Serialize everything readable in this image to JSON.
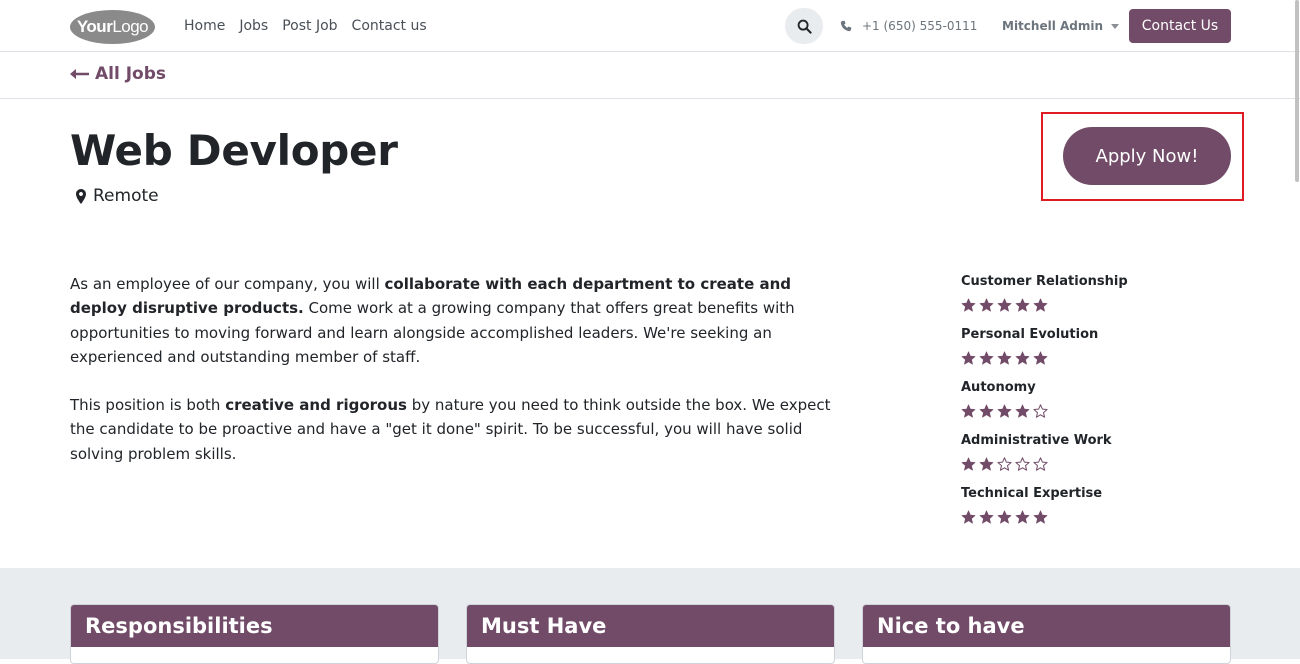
{
  "navbar": {
    "logo_light": "Your",
    "logo_text": "Logo",
    "menu": [
      "Home",
      "Jobs",
      "Post Job",
      "Contact us"
    ],
    "phone": "+1 (650) 555-0111",
    "user": "Mitchell Admin",
    "contact_button": "Contact Us"
  },
  "subnav": {
    "back_label": "All Jobs"
  },
  "job": {
    "title": "Web Devloper",
    "location": "Remote",
    "apply_button": "Apply Now!"
  },
  "description": {
    "p1": [
      {
        "text": "As an employee of our company, you will ",
        "bold": false
      },
      {
        "text": "collaborate with each department to create and deploy disruptive products.",
        "bold": true
      },
      {
        "text": " Come work at a growing company that offers great benefits with opportunities to moving forward and learn alongside accomplished leaders. We're seeking an experienced and outstanding member of staff.",
        "bold": false
      }
    ],
    "p2": [
      {
        "text": "This position is both ",
        "bold": false
      },
      {
        "text": "creative and rigorous",
        "bold": true
      },
      {
        "text": " by nature you need to think outside the box. We expect the candidate to be proactive and have a \"get it done\" spirit. To be successful, you will have solid solving problem skills.",
        "bold": false
      }
    ]
  },
  "skills": [
    {
      "name": "Customer Relationship",
      "rating": 5,
      "max": 5
    },
    {
      "name": "Personal Evolution",
      "rating": 5,
      "max": 5
    },
    {
      "name": "Autonomy",
      "rating": 4,
      "max": 5
    },
    {
      "name": "Administrative Work",
      "rating": 2,
      "max": 5
    },
    {
      "name": "Technical Expertise",
      "rating": 5,
      "max": 5
    }
  ],
  "cards": [
    "Responsibilities",
    "Must Have",
    "Nice to have"
  ],
  "colors": {
    "brand": "#714b67",
    "highlight_frame": "#e01b24",
    "section_bg": "#e9ecef"
  },
  "icons": [
    "search-icon",
    "phone-icon",
    "arrow-left-icon",
    "map-marker-icon",
    "star-icon"
  ]
}
